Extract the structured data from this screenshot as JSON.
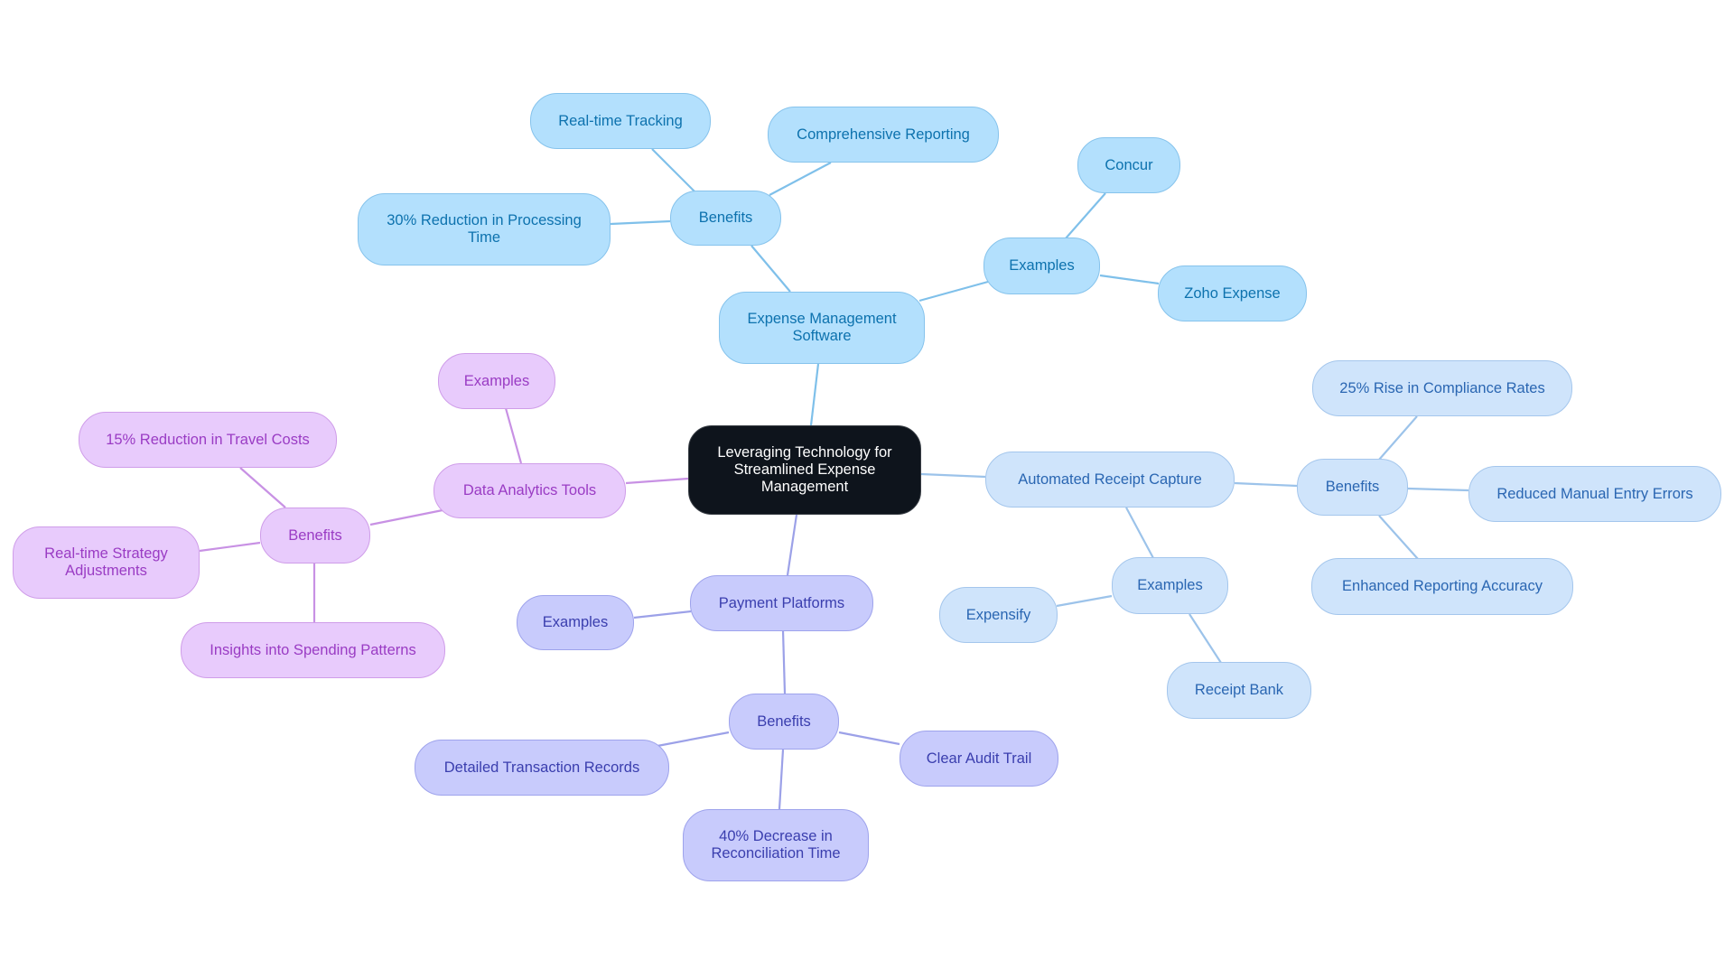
{
  "mindmap": {
    "root": {
      "label": "Leveraging Technology for Streamlined Expense Management"
    },
    "branches": [
      {
        "label": "Expense Management Software",
        "color": {
          "fill": "#b3e0fd",
          "text": "#0d72ae",
          "border": "#86c3ec",
          "edge": "#7fc0ea"
        },
        "benefits": {
          "label": "Benefits",
          "items": [
            "Real-time Tracking",
            "Comprehensive Reporting",
            "30% Reduction in Processing Time"
          ]
        },
        "examples": {
          "label": "Examples",
          "items": [
            "Concur",
            "Zoho Expense"
          ]
        }
      },
      {
        "label": "Automated Receipt Capture",
        "color": {
          "fill": "#cfe4fb",
          "text": "#2a66b2",
          "border": "#a4c6ec",
          "edge": "#9cc3ea"
        },
        "benefits": {
          "label": "Benefits",
          "items": [
            "25% Rise in Compliance Rates",
            "Reduced Manual Entry Errors",
            "Enhanced Reporting Accuracy"
          ]
        },
        "examples": {
          "label": "Examples",
          "items": [
            "Expensify",
            "Receipt Bank"
          ]
        }
      },
      {
        "label": "Data Analytics Tools",
        "color": {
          "fill": "#e8cbfc",
          "text": "#9a3cc4",
          "border": "#cf9de9",
          "edge": "#c891e4"
        },
        "examples": {
          "label": "Examples",
          "items": []
        },
        "benefits": {
          "label": "Benefits",
          "items": [
            "15% Reduction in Travel Costs",
            "Real-time Strategy Adjustments",
            "Insights into Spending Patterns"
          ]
        }
      },
      {
        "label": "Payment Platforms",
        "color": {
          "fill": "#c8cbfc",
          "text": "#3a3eae",
          "border": "#9ea3ec",
          "edge": "#9ca1e8"
        },
        "examples": {
          "label": "Examples",
          "items": []
        },
        "benefits": {
          "label": "Benefits",
          "items": [
            "Detailed Transaction Records",
            "Clear Audit Trail",
            "40% Decrease in Reconciliation Time"
          ]
        }
      }
    ]
  }
}
